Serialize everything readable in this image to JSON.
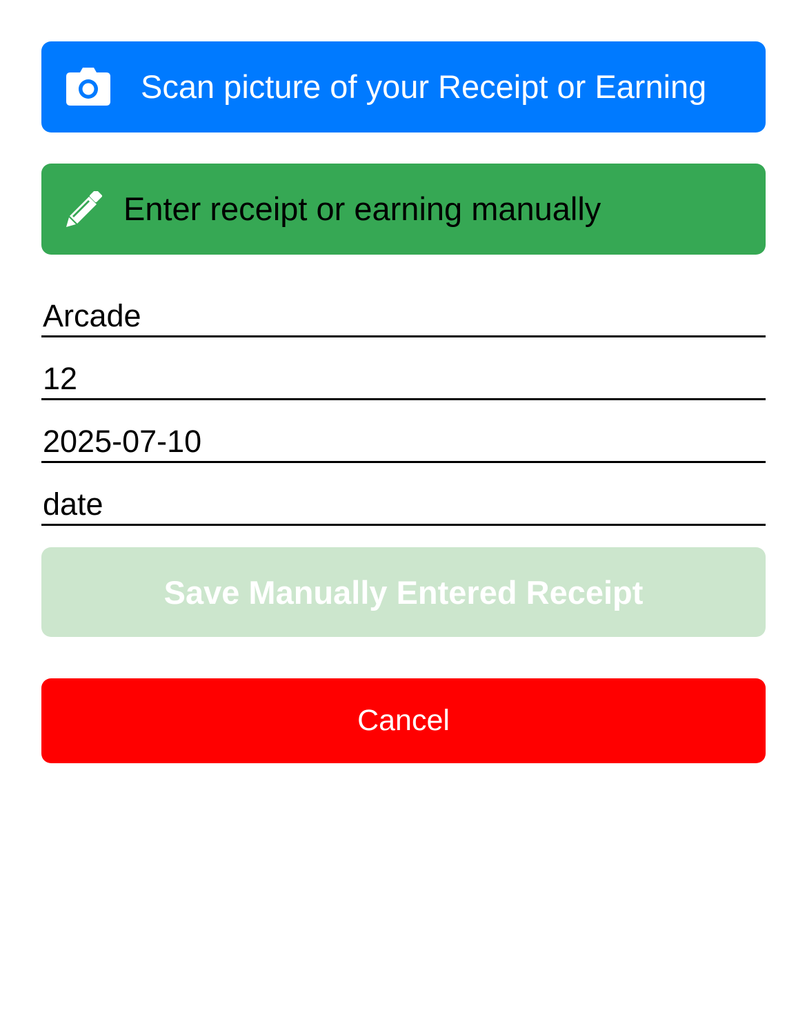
{
  "scan_button": {
    "label": "Scan picture of your Receipt or Earning",
    "icon": "camera-icon",
    "color": "#007aff"
  },
  "manual_button": {
    "label": "Enter receipt or earning manually",
    "icon": "pencil-icon",
    "color": "#36a854"
  },
  "form": {
    "name_value": "Arcade",
    "amount_value": "12",
    "date_value": "2025-07-10",
    "date2_placeholder": "date"
  },
  "save_button": {
    "label": "Save Manually Entered Receipt",
    "color": "#cce6cd"
  },
  "cancel_button": {
    "label": "Cancel",
    "color": "#ff0000"
  }
}
